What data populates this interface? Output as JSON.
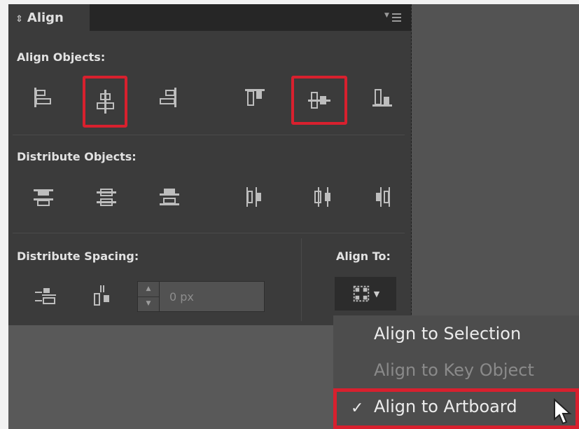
{
  "panel": {
    "tab_title": "Align",
    "align_objects_label": "Align Objects:",
    "distribute_objects_label": "Distribute Objects:",
    "distribute_spacing_label": "Distribute Spacing:",
    "align_to_label": "Align To:",
    "spacing_value": "0 px"
  },
  "align_to_menu": {
    "items": [
      {
        "label": "Align to Selection",
        "enabled": true,
        "checked": false
      },
      {
        "label": "Align to Key Object",
        "enabled": false,
        "checked": false
      },
      {
        "label": "Align to Artboard",
        "enabled": true,
        "checked": true
      }
    ],
    "check_mark": "✓"
  },
  "highlight_color": "#d8202e",
  "icons": {
    "align_objects": [
      "horizontal-align-left-icon",
      "horizontal-align-center-icon",
      "horizontal-align-right-icon",
      "vertical-align-top-icon",
      "vertical-align-center-icon",
      "vertical-align-bottom-icon"
    ],
    "distribute_objects": [
      "vertical-distribute-top-icon",
      "vertical-distribute-center-icon",
      "vertical-distribute-bottom-icon",
      "horizontal-distribute-left-icon",
      "horizontal-distribute-center-icon",
      "horizontal-distribute-right-icon"
    ],
    "distribute_spacing": [
      "vertical-distribute-space-icon",
      "horizontal-distribute-space-icon"
    ]
  }
}
